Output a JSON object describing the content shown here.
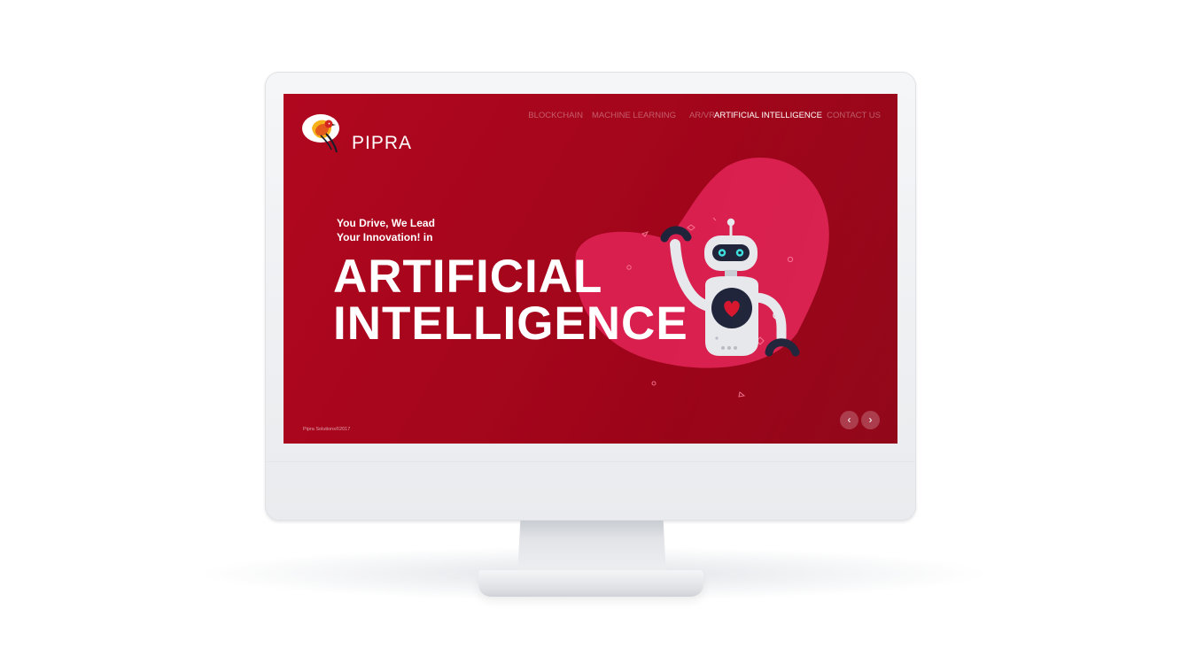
{
  "brand": {
    "name": "PIPRA"
  },
  "nav": {
    "items": [
      {
        "label": "BLOCKCHAIN"
      },
      {
        "label": "MACHINE LEARNING"
      },
      {
        "label": "AR/VR"
      },
      {
        "label": "ARTIFICIAL INTELLIGENCE",
        "active": true
      },
      {
        "label": "CONTACT US"
      }
    ]
  },
  "hero": {
    "tagline_line1": "You Drive, We Lead",
    "tagline_line2": "Your Innovation! in",
    "headline_line1": "ARTIFICIAL",
    "headline_line2": "INTELLIGENCE"
  },
  "footer": {
    "copyright": "Pipra Solutions©2017"
  },
  "slider": {
    "prev_icon": "chevron-left-icon",
    "next_icon": "chevron-right-icon",
    "prev_glyph": "‹",
    "next_glyph": "›"
  },
  "colors": {
    "screen_bg": "#a5061c",
    "blob": "#d91f4e",
    "robot_body": "#e6e8ec",
    "robot_dark": "#20243a",
    "eyes": "#3ee0e0",
    "heart": "#d6162e"
  }
}
